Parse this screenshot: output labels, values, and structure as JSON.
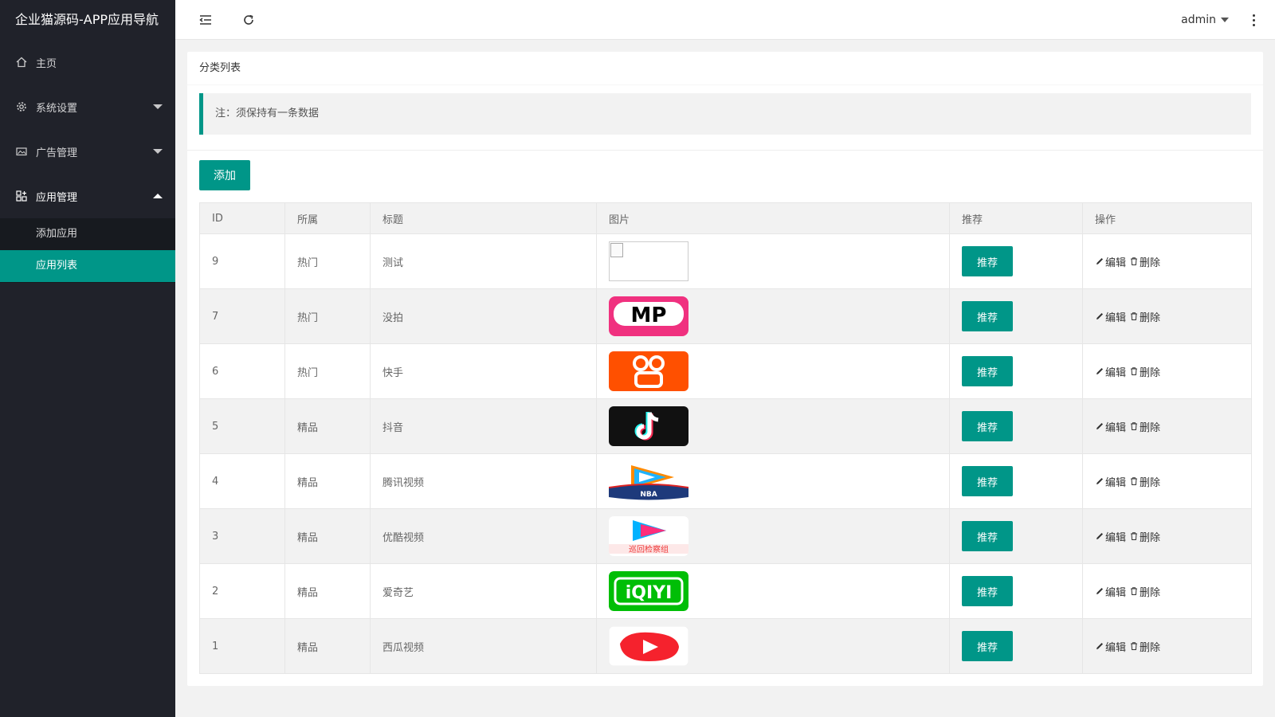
{
  "app": {
    "title": "企业猫源码-APP应用导航"
  },
  "sidebar": {
    "items": [
      {
        "label": "主页",
        "icon": "home-icon"
      },
      {
        "label": "系统设置",
        "icon": "gear-icon"
      },
      {
        "label": "广告管理",
        "icon": "image-icon"
      },
      {
        "label": "应用管理",
        "icon": "apps-icon"
      }
    ],
    "sub": [
      {
        "label": "添加应用"
      },
      {
        "label": "应用列表"
      }
    ]
  },
  "header": {
    "user": "admin"
  },
  "card": {
    "title": "分类列表",
    "note": "注：须保持有一条数据",
    "add_label": "添加"
  },
  "table": {
    "headers": [
      "ID",
      "所属",
      "标题",
      "图片",
      "推荐",
      "操作"
    ],
    "rows": [
      {
        "id": "9",
        "category": "热门",
        "title": "测试",
        "image": "broken-image",
        "recommend": "推荐",
        "edit": "编辑",
        "delete": "删除"
      },
      {
        "id": "7",
        "category": "热门",
        "title": "没拍",
        "image": "mp-logo",
        "recommend": "推荐",
        "edit": "编辑",
        "delete": "删除"
      },
      {
        "id": "6",
        "category": "热门",
        "title": "快手",
        "image": "kuaishou-logo",
        "recommend": "推荐",
        "edit": "编辑",
        "delete": "删除"
      },
      {
        "id": "5",
        "category": "精品",
        "title": "抖音",
        "image": "douyin-logo",
        "recommend": "推荐",
        "edit": "编辑",
        "delete": "删除"
      },
      {
        "id": "4",
        "category": "精品",
        "title": "腾讯视频",
        "image": "tencent-video-logo",
        "recommend": "推荐",
        "edit": "编辑",
        "delete": "删除"
      },
      {
        "id": "3",
        "category": "精品",
        "title": "优酷视频",
        "image": "youku-logo",
        "recommend": "推荐",
        "edit": "编辑",
        "delete": "删除"
      },
      {
        "id": "2",
        "category": "精品",
        "title": "爱奇艺",
        "image": "iqiyi-logo",
        "recommend": "推荐",
        "edit": "编辑",
        "delete": "删除"
      },
      {
        "id": "1",
        "category": "精品",
        "title": "西瓜视频",
        "image": "xigua-logo",
        "recommend": "推荐",
        "edit": "编辑",
        "delete": "删除"
      }
    ]
  },
  "colors": {
    "accent": "#009688",
    "sidebar": "#20222a",
    "subnav": "#171a1f"
  }
}
